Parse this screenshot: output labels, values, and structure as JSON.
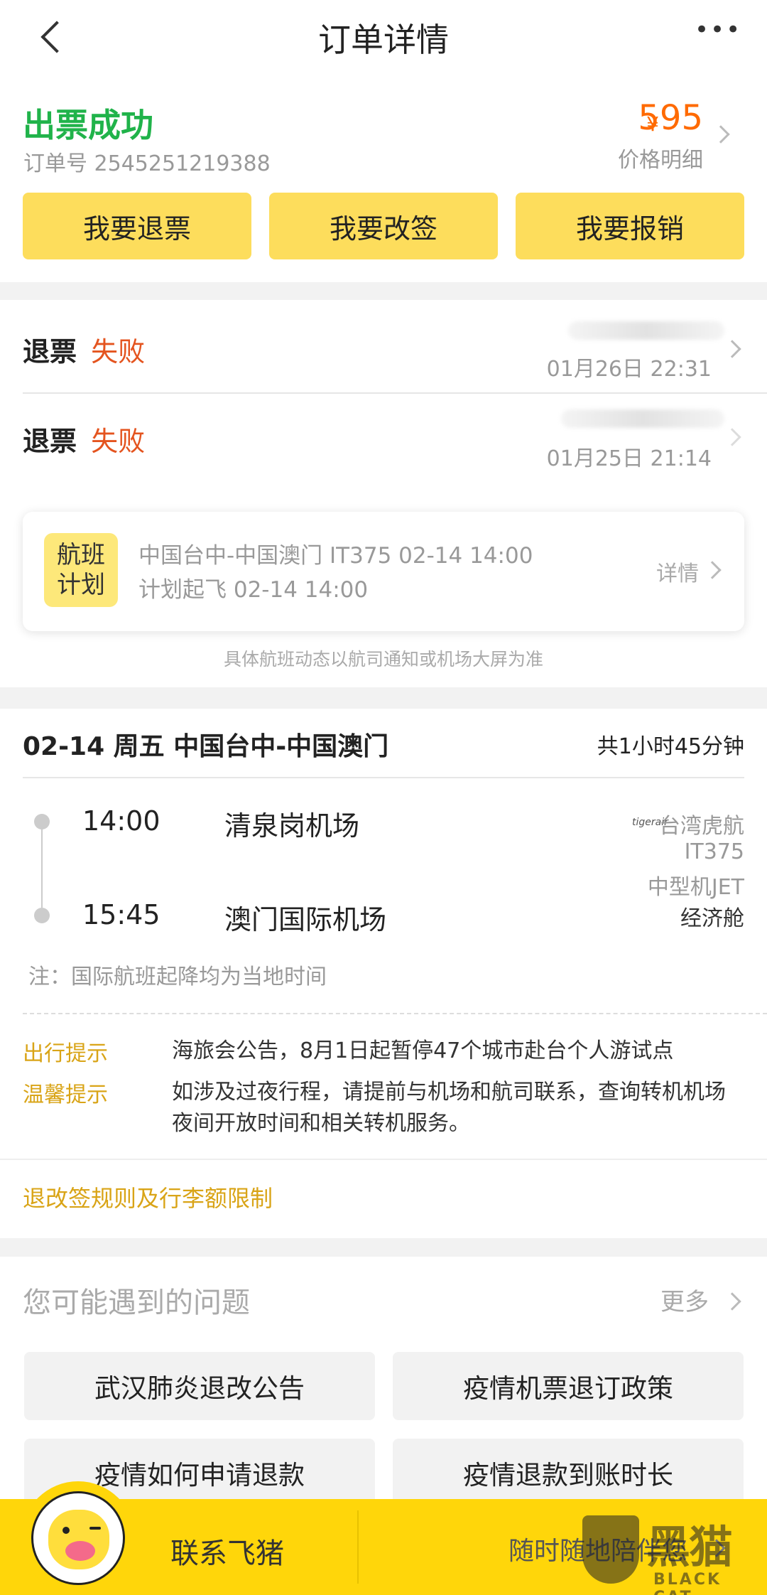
{
  "header": {
    "title": "订单详情",
    "more": "•••"
  },
  "order": {
    "status": "出票成功",
    "number_label": "订单号",
    "number": "2545251219388",
    "currency": "¥",
    "price": "595",
    "price_detail": "价格明细"
  },
  "actions": [
    "我要退票",
    "我要改签",
    "我要报销"
  ],
  "refunds": [
    {
      "label": "退票",
      "status": "失败",
      "time": "01月26日 22:31"
    },
    {
      "label": "退票",
      "status": "失败",
      "time": "01月25日 21:14"
    }
  ],
  "plan_card": {
    "badge_line1": "航班",
    "badge_line2": "计划",
    "route_line": "中国台中-中国澳门 IT375 02-14 14:00",
    "takeoff_line": "计划起飞 02-14 14:00",
    "detail": "详情"
  },
  "plan_note": "具体航班动态以航司通知或机场大屏为准",
  "flight": {
    "date_route": "02-14 周五 中国台中-中国澳门",
    "duration": "共1小时45分钟",
    "dep_time": "14:00",
    "dep_airport": "清泉岗机场",
    "arr_time": "15:45",
    "arr_airport": "澳门国际机场",
    "airline_logo": "tigerair",
    "airline": "台湾虎航",
    "flight_no": "IT375",
    "aircraft": "中型机JET",
    "cabin": "经济舱",
    "note": "注：国际航班起降均为当地时间"
  },
  "tips": [
    {
      "label": "出行提示",
      "text": "海旅会公告，8月1日起暂停47个城市赴台个人游试点"
    },
    {
      "label": "温馨提示",
      "text": "如涉及过夜行程，请提前与机场和航司联系，查询转机机场夜间开放时间和相关转机服务。"
    }
  ],
  "rules_link": "退改签规则及行李额限制",
  "faq": {
    "title": "您可能遇到的问题",
    "more": "更多",
    "items": [
      "武汉肺炎退改公告",
      "疫情机票退订政策",
      "疫情如何申请退款",
      "疫情退款到账时长"
    ]
  },
  "footer": {
    "contact": "联系飞猪",
    "slogan": "随时随地陪伴您",
    "watermark_cn": "黑猫",
    "watermark_en": "BLACK CAT"
  },
  "colors": {
    "accent_yellow": "#fddd5c",
    "success_green": "#20b34a",
    "price_orange": "#ff6a00",
    "tip_gold": "#d9a417"
  }
}
